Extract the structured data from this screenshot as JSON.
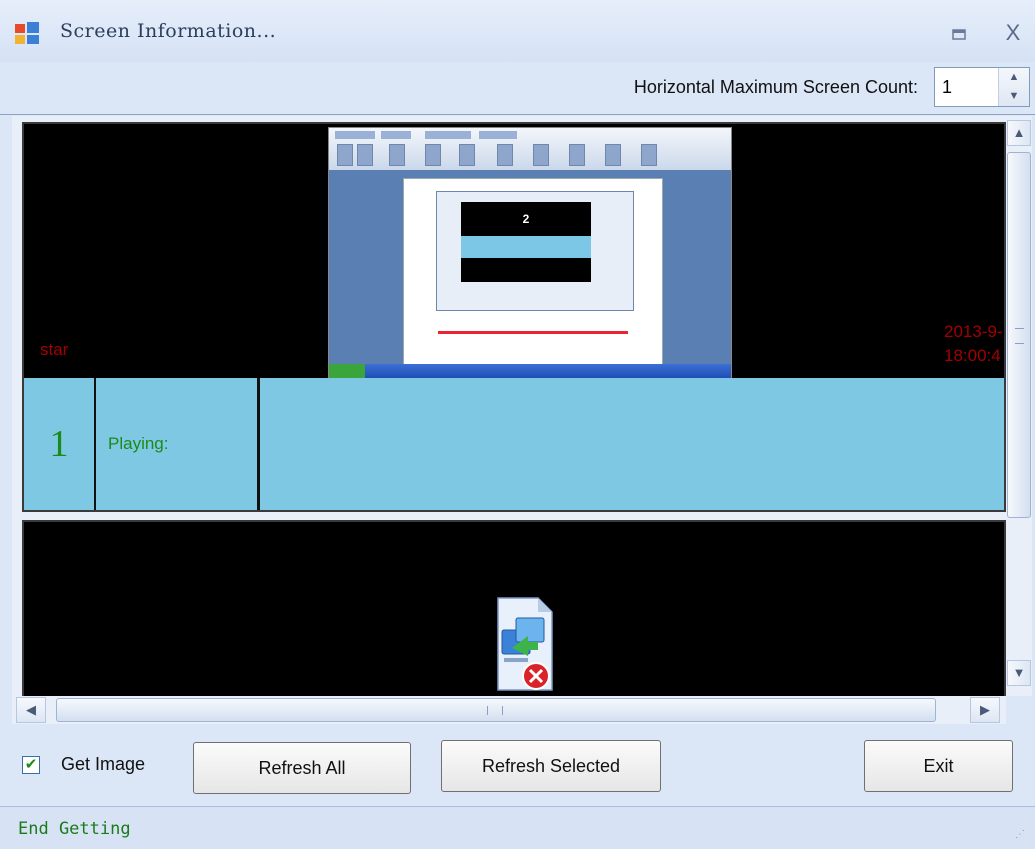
{
  "window": {
    "title": "Screen Information...",
    "minimize_icon": "minimize-icon",
    "close_label": "X"
  },
  "toolbar": {
    "horizontal_count_label": "Horizontal Maximum Screen Count:",
    "horizontal_count_value": "1"
  },
  "screens": [
    {
      "index": "1",
      "status_label": "Playing:",
      "left_label": "star",
      "date_label": "2013-9-",
      "time_label": "18:00:4",
      "thumbnail_number": "2"
    },
    {
      "image_state": "broken-image-icon"
    }
  ],
  "controls": {
    "get_image_label": "Get Image",
    "get_image_checked": true,
    "refresh_all_label": "Refresh All",
    "refresh_selected_label": "Refresh Selected",
    "exit_label": "Exit"
  },
  "statusbar": {
    "text": "End Getting"
  },
  "colors": {
    "info_row": "#7ec8e3",
    "status_green": "#1b8a1b",
    "overlay_red": "#a30000"
  }
}
